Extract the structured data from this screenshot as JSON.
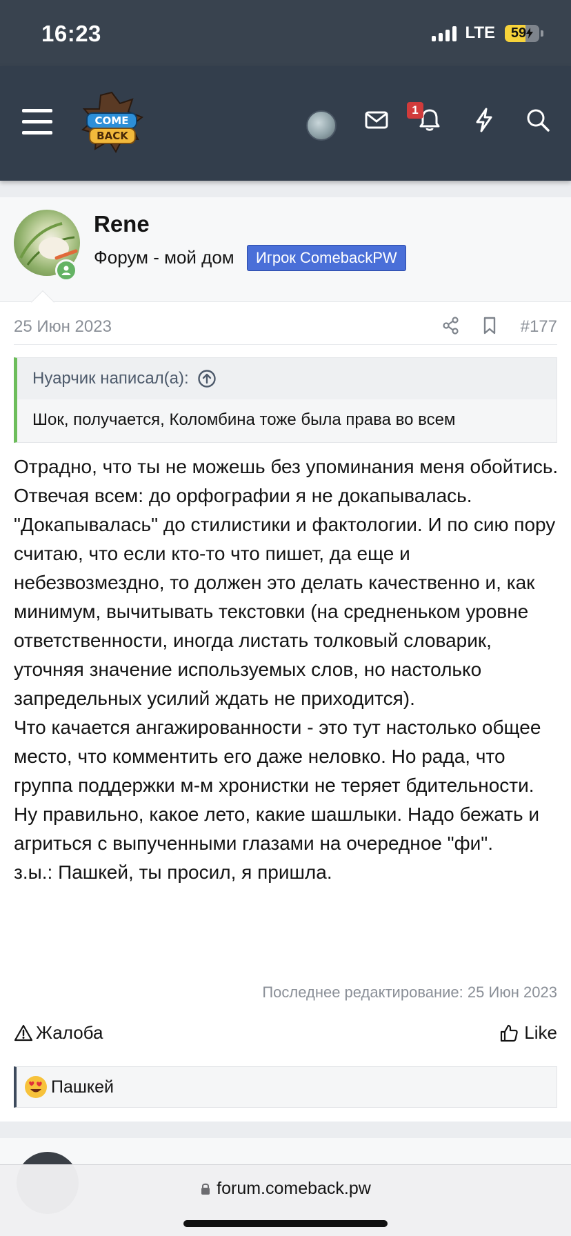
{
  "status_bar": {
    "time": "16:23",
    "network": "LTE",
    "battery": "59",
    "battery_level": 0.59
  },
  "nav": {
    "logo_text": "ComeBack",
    "notification_count": "1",
    "icons": [
      "menu-icon",
      "avatar",
      "mail-icon",
      "bell-icon",
      "bolt-icon",
      "search-icon"
    ]
  },
  "post": {
    "username": "Rene",
    "user_title": "Форум - мой дом",
    "user_banner": "Игрок ComebackPW",
    "date": "25 Июн 2023",
    "number": "#177",
    "quote": {
      "author": "Нуарчик написал(а):",
      "text": "Шок, получается, Коломбина тоже была права во всем"
    },
    "paragraphs": [
      "Отрадно, что ты не можешь без упоминания меня обойтись.",
      "Отвечая всем: до орфографии я не докапывалась. \"Докапывалась\" до стилистики и фактологии. И по сию пору считаю, что если кто-то что пишет, да еще и небезвозмездно, то должен это делать качественно и, как минимум, вычитывать текстовки (на средненьком уровне ответственности, иногда листать толковый словарик, уточняя значение используемых слов, но настолько запредельных усилий ждать не приходится).",
      "Что качается ангажированности - это тут настолько общее место, что комментить его даже неловко. Но рада, что группа поддержки м-м хронистки не теряет бдительности. Ну правильно, какое лето, какие шашлыки. Надо бежать и агриться с выпученными глазами на очередное \"фи\".",
      "з.ы.: Пашкей, ты просил, я пришла."
    ],
    "last_edit": "Последнее редактирование: 25 Июн 2023",
    "report_label": "Жалоба",
    "like_label": "Like",
    "reaction_user": "Пашкей"
  },
  "browser": {
    "url": "forum.comeback.pw"
  },
  "colors": {
    "nav_bg": "#333e4c",
    "status_bg": "#39434f",
    "banner_blue": "#4a6fd8",
    "quote_green": "#6dbd5b",
    "badge_red": "#d13b3b",
    "online_green": "#64b364"
  }
}
